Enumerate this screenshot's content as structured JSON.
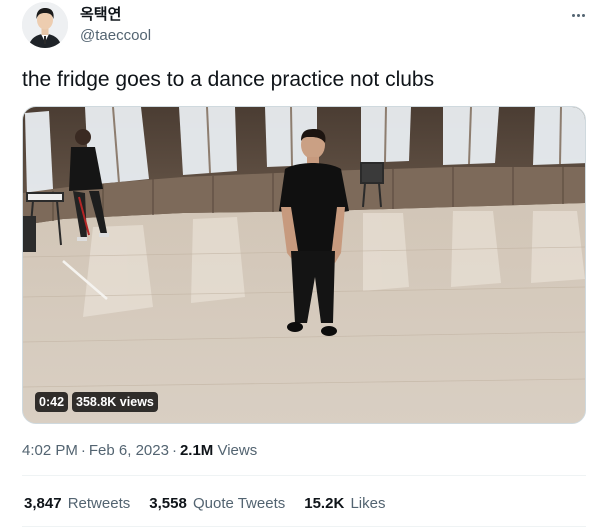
{
  "author": {
    "display_name": "옥택연",
    "handle": "@taeccool",
    "avatar_icon": "profile-photo"
  },
  "more_icon": "ellipsis-icon",
  "tweet": {
    "text": "the fridge goes to a dance practice not clubs"
  },
  "video": {
    "duration": "0:42",
    "views": "358.8K views"
  },
  "meta": {
    "time": "4:02 PM",
    "date": "Feb 6, 2023",
    "view_count": "2.1M",
    "view_label": "Views"
  },
  "stats": {
    "retweets_count": "3,847",
    "retweets_label": "Retweets",
    "quotes_count": "3,558",
    "quotes_label": "Quote Tweets",
    "likes_count": "15.2K",
    "likes_label": "Likes"
  },
  "colors": {
    "text_primary": "#0f1419",
    "text_secondary": "#536471",
    "divider": "#eff3f4"
  }
}
